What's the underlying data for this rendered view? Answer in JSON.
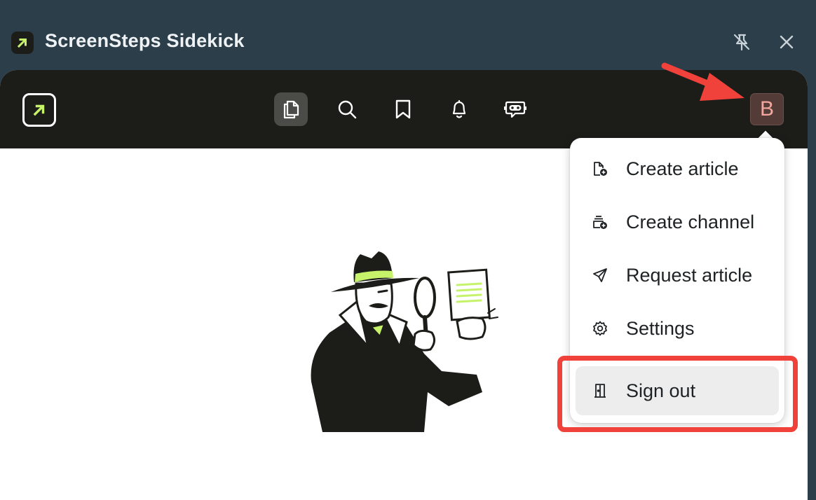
{
  "window": {
    "title": "ScreenSteps Sidekick",
    "logo_icon": "arrow-up-right-icon",
    "controls": [
      "pin-off-icon",
      "close-icon"
    ]
  },
  "topnav": {
    "icons": [
      "articles-icon",
      "search-icon",
      "bookmark-icon",
      "bell-icon",
      "chatbot-icon"
    ],
    "active": "articles-icon",
    "avatar_letter": "B"
  },
  "menu": {
    "items": [
      {
        "label": "Create article",
        "icon": "file-plus-icon"
      },
      {
        "label": "Create channel",
        "icon": "channel-plus-icon"
      },
      {
        "label": "Request article",
        "icon": "send-icon"
      },
      {
        "label": "Settings",
        "icon": "gear-icon"
      }
    ],
    "sign_out": {
      "label": "Sign out",
      "icon": "door-icon"
    }
  },
  "colors": {
    "window_bg": "#2b3e4a",
    "nav_bg": "#1c1d19",
    "accent": "#c6f36a",
    "avatar_bg": "#533b38",
    "annotation": "#f0413a"
  }
}
